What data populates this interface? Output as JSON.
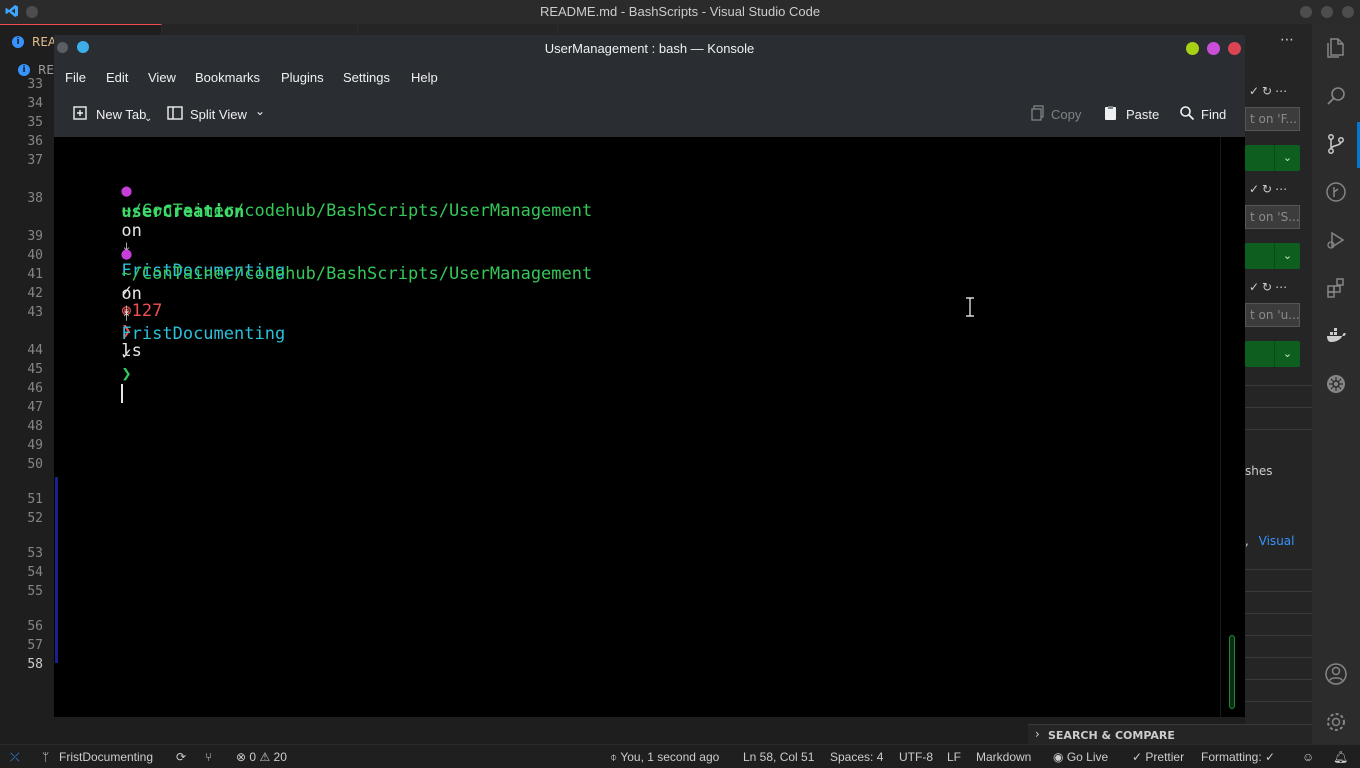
{
  "vscode": {
    "title": "README.md - BashScripts - Visual Studio Code",
    "tab_label": "REA",
    "breadcrumb": "RE",
    "line_numbers": [
      "33",
      "34",
      "35",
      "36",
      "37",
      "38",
      "39",
      "40",
      "41",
      "42",
      "43",
      "44",
      "45",
      "46",
      "47",
      "48",
      "49",
      "50",
      "51",
      "52",
      "53",
      "54",
      "55",
      "56",
      "57",
      "58"
    ],
    "active_line": "58",
    "right_panel": {
      "input1": "t on 'F...",
      "input2": "t on 'S...",
      "input3": "t on 'u...",
      "text_shes": "shes",
      "link_visual": "Visual",
      "comma": ","
    },
    "search_compare_label": "SEARCH & COMPARE",
    "status": {
      "branch": "FristDocumenting",
      "problems_errors": "0",
      "problems_warnings": "20",
      "blame": "You, 1 second ago",
      "cursor_pos": "Ln 58, Col 51",
      "spaces": "Spaces: 4",
      "encoding": "UTF-8",
      "eol": "LF",
      "language": "Markdown",
      "go_live": "Go Live",
      "prettier": "Prettier",
      "formatting": "Formatting: ✓"
    }
  },
  "konsole": {
    "title": "UserManagement : bash — Konsole",
    "menu": [
      "File",
      "Edit",
      "View",
      "Bookmarks",
      "Plugins",
      "Settings",
      "Help"
    ],
    "toolbar": {
      "new_tab": "New Tab",
      "split_view": "Split View",
      "copy": "Copy",
      "paste": "Paste",
      "find": "Find"
    },
    "terminal": {
      "path": "~/ConTainer/codehub/BashScripts/UserManagement",
      "on": "on",
      "branch_symbol": "",
      "branch": "FristDocumenting",
      "check": "✓",
      "exit_code": "127",
      "prompt_char": "❯",
      "command1": "ls",
      "output1": "userCreation"
    }
  },
  "colors": {
    "terminal_bg": "#000000",
    "path_green": "#34c759",
    "branch_cyan": "#2bc0d9",
    "error_red": "#f04f4f",
    "github_pink": "#c53fd8"
  }
}
